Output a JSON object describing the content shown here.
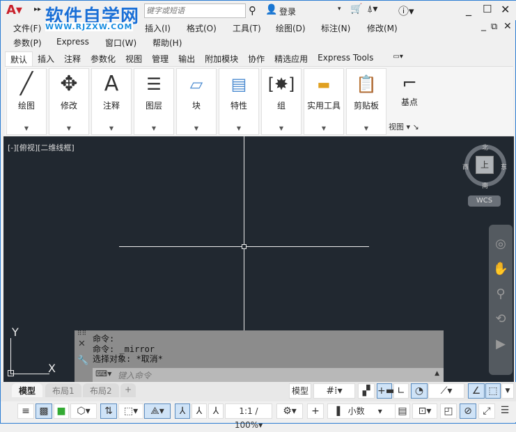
{
  "titlebar": {
    "search_placeholder": "键字或短语",
    "login": "登录",
    "watermark": "软件自学网",
    "watermark_url": "WWW.RJZXW.COM"
  },
  "menus": [
    "文件(F)",
    "插入(I)",
    "格式(O)",
    "工具(T)",
    "绘图(D)",
    "标注(N)",
    "修改(M)",
    "参数(P)",
    "Express",
    "窗口(W)",
    "帮助(H)"
  ],
  "ribbon_tabs": [
    "默认",
    "插入",
    "注释",
    "参数化",
    "视图",
    "管理",
    "输出",
    "附加模块",
    "协作",
    "精选应用",
    "Express Tools"
  ],
  "panels": [
    {
      "label": "绘图",
      "icon": "line-icon"
    },
    {
      "label": "修改",
      "icon": "move-icon"
    },
    {
      "label": "注释",
      "icon": "text-icon"
    },
    {
      "label": "图层",
      "icon": "layers-icon"
    },
    {
      "label": "块",
      "icon": "block-icon"
    },
    {
      "label": "特性",
      "icon": "properties-icon"
    },
    {
      "label": "组",
      "icon": "group-icon"
    },
    {
      "label": "实用工具",
      "icon": "measure-icon"
    },
    {
      "label": "剪贴板",
      "icon": "clipboard-icon"
    }
  ],
  "view_panel": {
    "basepoint": "基点",
    "view": "视图"
  },
  "viewport": {
    "label": "[-][俯视][二维线框]",
    "compass": {
      "n": "北",
      "s": "南",
      "e": "东",
      "w": "西",
      "top": "上"
    },
    "wcs": "WCS"
  },
  "command": {
    "history": [
      "命令:",
      "命令: _mirror",
      "选择对象: *取消*"
    ],
    "placeholder": "键入命令"
  },
  "layout_tabs": [
    "模型",
    "布局1",
    "布局2",
    "+"
  ],
  "status": {
    "model": "模型",
    "scale": "1:1 / 100%",
    "units": "小数"
  },
  "ucs": {
    "x": "X",
    "y": "Y"
  }
}
